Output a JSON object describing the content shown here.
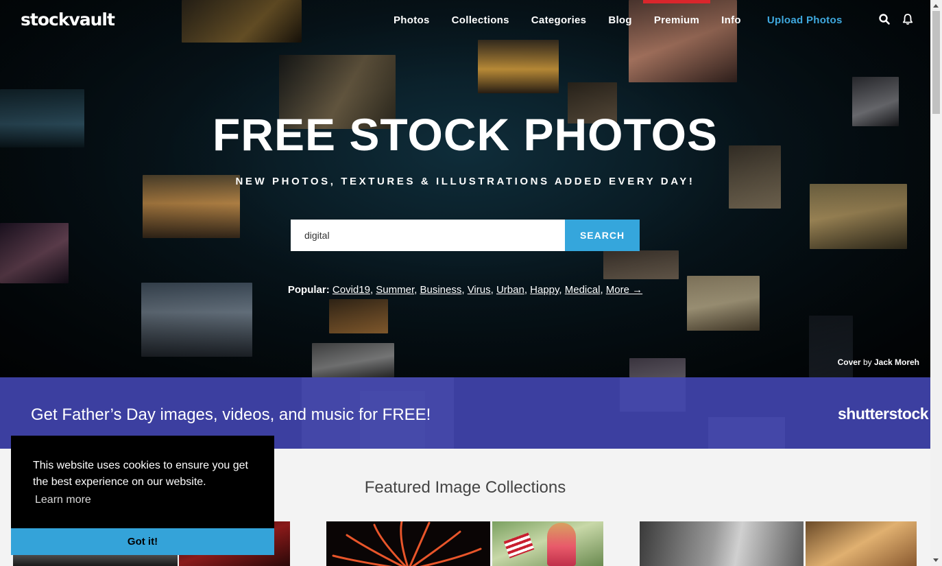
{
  "brand": {
    "logo": "stockvault"
  },
  "nav": {
    "items": [
      {
        "label": "Photos"
      },
      {
        "label": "Collections"
      },
      {
        "label": "Categories"
      },
      {
        "label": "Blog"
      },
      {
        "label": "Premium"
      },
      {
        "label": "Info"
      },
      {
        "label": "Upload Photos"
      }
    ],
    "icons": [
      "search-icon",
      "bell-icon"
    ],
    "accent": "#d9262c",
    "upload_color": "#3fa9df"
  },
  "hero": {
    "title": "FREE STOCK PHOTOS",
    "subtitle": "NEW PHOTOS, TEXTURES & ILLUSTRATIONS ADDED EVERY DAY!",
    "search": {
      "value": "digital",
      "button": "SEARCH"
    },
    "popular": {
      "label": "Popular:",
      "tags": [
        "Covid19",
        "Summer",
        "Business",
        "Virus",
        "Urban",
        "Happy",
        "Medical",
        "More →"
      ]
    },
    "credit": {
      "prefix": "Cover",
      "by": "by",
      "author": "Jack Moreh"
    }
  },
  "banner": {
    "text": "Get Father’s Day images, videos, and music for FREE!",
    "logo": "shutterstock",
    "color": "#3c3fa0"
  },
  "featured": {
    "title": "Featured Image Collections"
  },
  "cookie": {
    "message": "This website uses cookies to ensure you get the best experience on our website.",
    "link": "Learn more",
    "button": "Got it!",
    "button_color": "#34a3d9"
  }
}
